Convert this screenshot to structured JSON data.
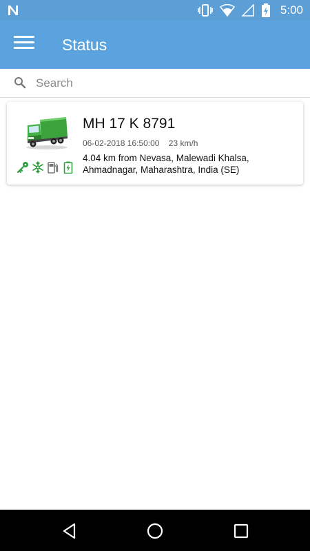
{
  "status_bar": {
    "time": "5:00",
    "icons": [
      "notification-n-icon",
      "vibrate-icon",
      "wifi-icon",
      "no-signal-icon",
      "battery-charging-icon"
    ]
  },
  "app_bar": {
    "title": "Status",
    "menu_icon": "hamburger-menu-icon",
    "background": "#5ba3de"
  },
  "search": {
    "placeholder": "Search",
    "value": "",
    "icon": "search-icon"
  },
  "vehicles": [
    {
      "plate": "MH 17 K 8791",
      "timestamp": "06-02-2018 16:50:00",
      "speed": "23 km/h",
      "location": "4.04 km from Nevasa, Malewadi Khalsa, Ahmadnagar, Maharashtra, India (SE)",
      "image": "green-truck-icon",
      "status_icons": [
        "ignition-key-icon",
        "ac-snowflake-icon",
        "fuel-pump-icon",
        "battery-icon"
      ],
      "status_colors": {
        "ignition": "#2e9e3e",
        "ac": "#2e9e3e",
        "fuel": "#777777",
        "battery": "#2e9e3e"
      }
    }
  ],
  "nav_bar": {
    "buttons": [
      "back-icon",
      "home-icon",
      "recents-icon"
    ]
  }
}
